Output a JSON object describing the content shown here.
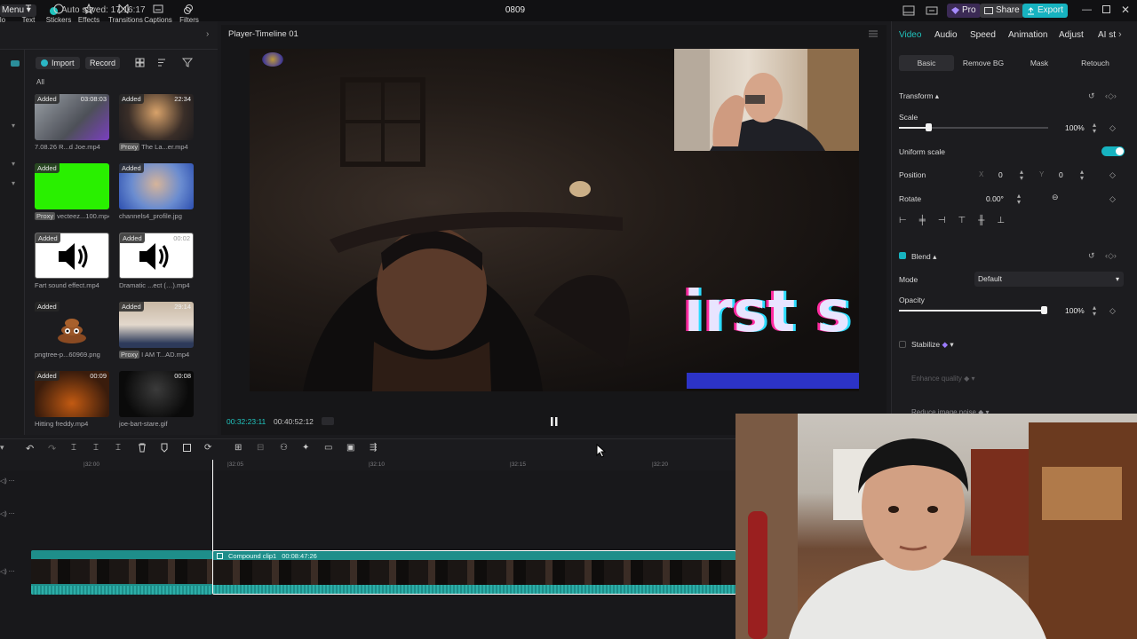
{
  "titlebar": {
    "menu_label": "Menu",
    "autosave": "Auto saved: 17:16:17",
    "project_name": "0809",
    "pro_label": "Pro",
    "share_label": "Share",
    "export_label": "Export"
  },
  "left_tools": [
    {
      "label": "Text"
    },
    {
      "label": "Stickers"
    },
    {
      "label": "Effects"
    },
    {
      "label": "Transitions"
    },
    {
      "label": "Captions"
    },
    {
      "label": "Filters"
    }
  ],
  "media": {
    "import_label": "Import",
    "record_label": "Record",
    "filter_all": "All",
    "added_label": "Added",
    "proxy_label": "Proxy",
    "items": [
      {
        "name": "7.08.26 R...d Joe.mp4",
        "duration": "03:08:03"
      },
      {
        "name": "The La...er.mp4",
        "duration": "22:34"
      },
      {
        "name": "vecteez...100.mp4",
        "duration": ""
      },
      {
        "name": "channels4_profile.jpg",
        "duration": ""
      },
      {
        "name": "Fart sound effect.mp4",
        "duration": ""
      },
      {
        "name": "Dramatic ...ect (…).mp4",
        "duration": "00:02"
      },
      {
        "name": "pngtree-p...60969.png",
        "duration": ""
      },
      {
        "name": "I AM T...AD.mp4",
        "duration": "29:14"
      },
      {
        "name": "Hitting freddy.mp4",
        "duration": "00:09"
      },
      {
        "name": "joe-bart-stare.gif",
        "duration": "00:08"
      }
    ]
  },
  "player": {
    "title": "Player-Timeline 01",
    "overlay_text": "irst s",
    "time_current": "00:32:23:11",
    "time_total": "00:40:52:12"
  },
  "props": {
    "tabs": [
      "Video",
      "Audio",
      "Speed",
      "Animation",
      "Adjust",
      "AI st"
    ],
    "subtabs": [
      "Basic",
      "Remove BG",
      "Mask",
      "Retouch"
    ],
    "transform_label": "Transform",
    "scale_label": "Scale",
    "scale_value": "100%",
    "scale_fraction": 0.2,
    "uniform_label": "Uniform scale",
    "position_label": "Position",
    "pos_x_label": "X",
    "pos_x": "0",
    "pos_y_label": "Y",
    "pos_y": "0",
    "rotate_label": "Rotate",
    "rotate_value": "0.00°",
    "blend_label": "Blend",
    "mode_label": "Mode",
    "mode_value": "Default",
    "opacity_label": "Opacity",
    "opacity_value": "100%",
    "opacity_fraction": 1.0,
    "stabilize_label": "Stabilize",
    "enhance_label": "Enhance quality",
    "reduce_noise_label": "Reduce image noise"
  },
  "timeline": {
    "ruler": [
      "|32:00",
      "|32:05",
      "|32:10",
      "|32:15",
      "|32:20"
    ],
    "clip_label": "Compound clip1",
    "clip_duration": "00:08:47:26"
  },
  "colors": {
    "accent": "#17b3c0",
    "clip": "#1e8e8a",
    "pro": "#7b5cff"
  }
}
